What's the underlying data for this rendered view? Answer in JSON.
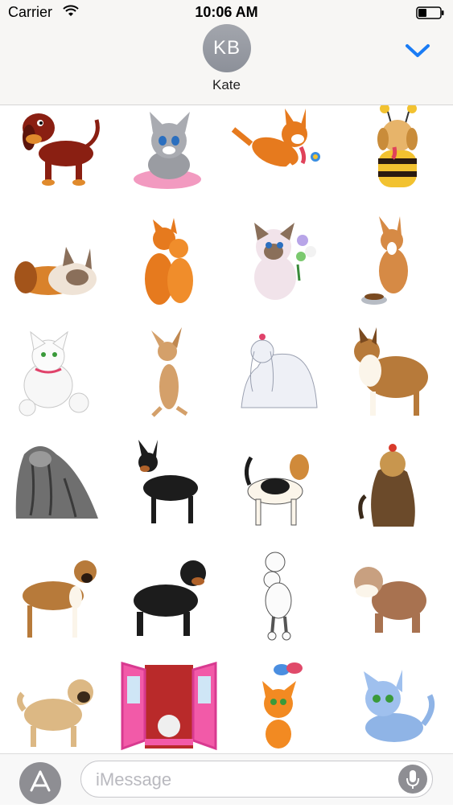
{
  "status_bar": {
    "carrier": "Carrier",
    "time": "10:06 AM"
  },
  "header": {
    "avatar_initials": "KB",
    "contact_name": "Kate"
  },
  "colors": {
    "accent": "#1a7cf5",
    "header_bg": "#f7f6f4",
    "icon_gray": "#8e8e93"
  },
  "stickers": [
    "dachshund",
    "gray-kitten-on-cushion",
    "running-corgi-with-ball",
    "puppy-in-bee-costume",
    "sleeping-puppy-and-kitten",
    "two-orange-cats",
    "siamese-cat-with-flowers",
    "dog-with-food-bowl",
    "white-cat-with-kittens",
    "chihuahua",
    "maltese",
    "collie",
    "afghan-hound",
    "doberman",
    "beagle",
    "yorkshire-terrier",
    "boxer",
    "rottweiler",
    "poodle",
    "bulldog",
    "pug",
    "kitten-in-window",
    "orange-cat-with-butterfly",
    "blue-kitten"
  ],
  "composer": {
    "placeholder": "iMessage"
  }
}
